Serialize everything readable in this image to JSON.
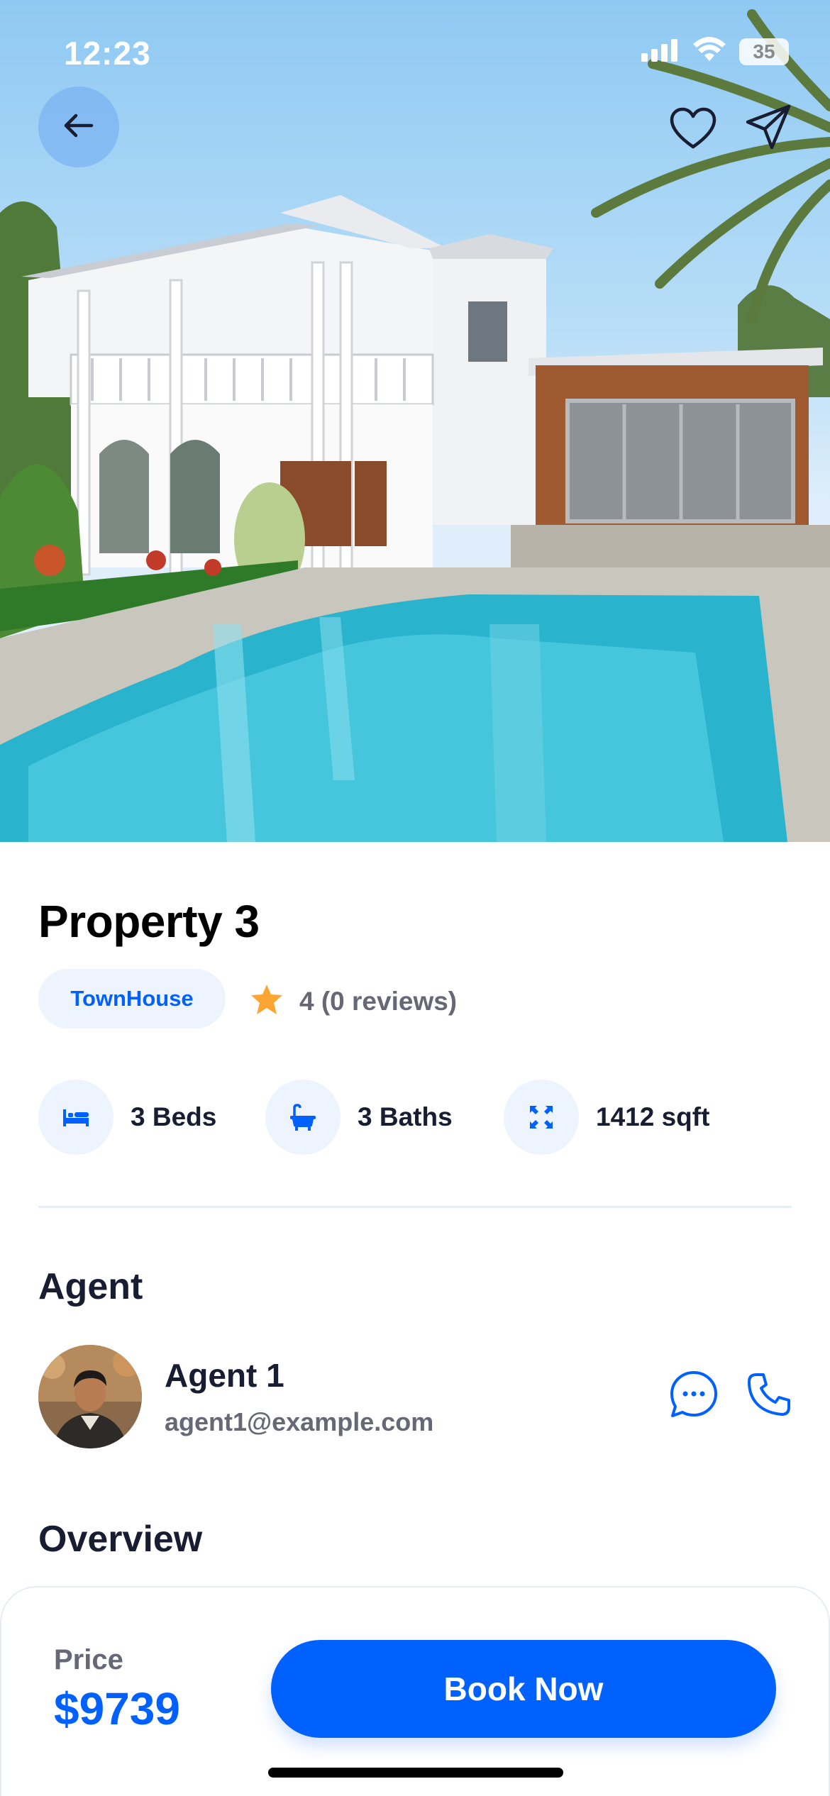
{
  "status_bar": {
    "time": "12:23",
    "battery": "35"
  },
  "header": {
    "icons": [
      "arrow-left-icon",
      "heart-icon",
      "send-icon"
    ]
  },
  "property": {
    "title": "Property 3",
    "type": "TownHouse",
    "rating_text": "4 (0 reviews)",
    "facts": [
      {
        "icon": "bed-icon",
        "label": "3 Beds"
      },
      {
        "icon": "bath-icon",
        "label": "3 Baths"
      },
      {
        "icon": "area-icon",
        "label": "1412 sqft"
      }
    ]
  },
  "agent": {
    "section_title": "Agent",
    "name": "Agent 1",
    "email": "agent1@example.com"
  },
  "overview": {
    "section_title": "Overview"
  },
  "footer": {
    "price_label": "Price",
    "price_value": "$9739",
    "book_label": "Book Now"
  },
  "colors": {
    "accent": "#0061ff",
    "chip_bg": "#eef4fd",
    "text_primary": "#191d31",
    "text_secondary": "#666876",
    "star": "#fba533"
  }
}
